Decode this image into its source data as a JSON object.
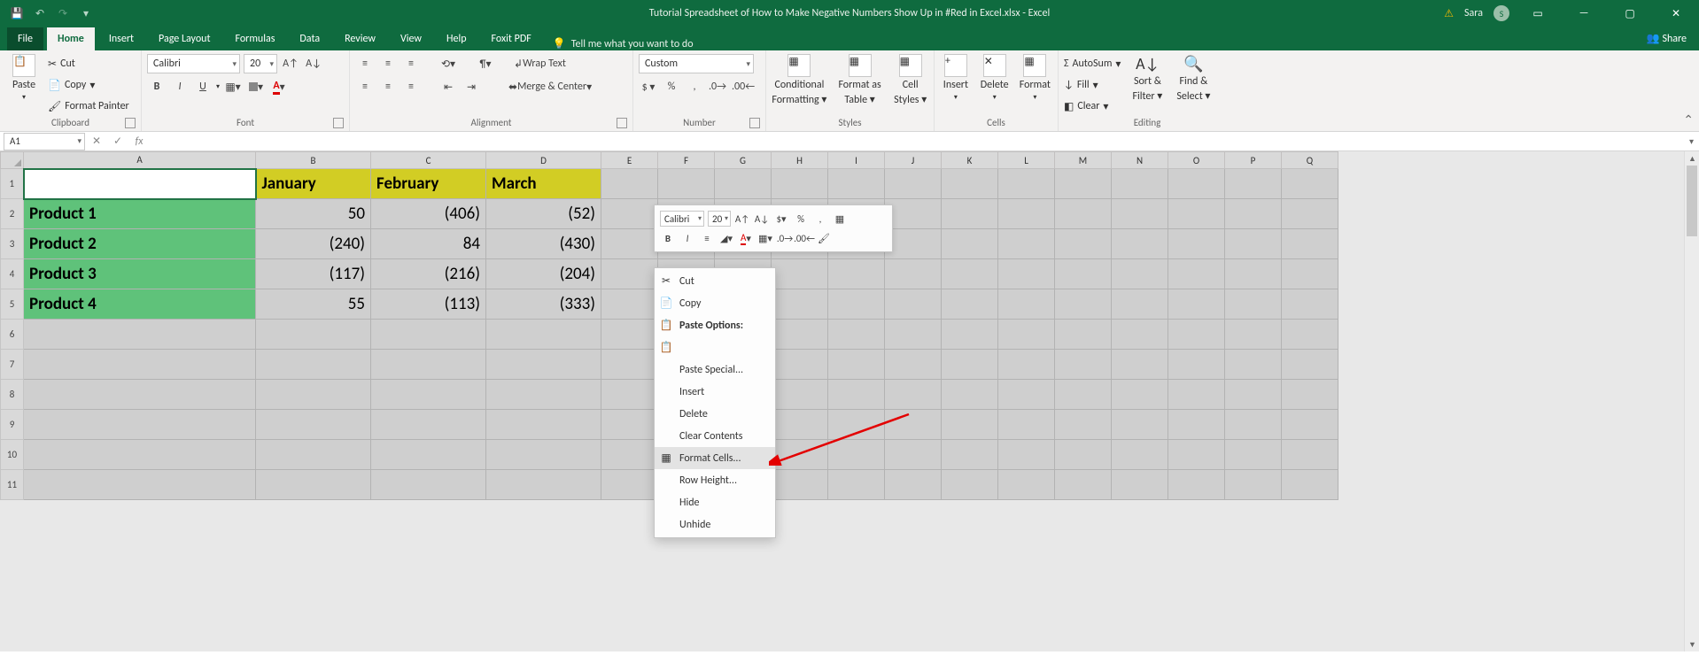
{
  "titlebar": {
    "title": "Tutorial Spreadsheet of How to Make Negative Numbers Show Up in #Red in Excel.xlsx - Excel",
    "user_name": "Sara",
    "user_initial": "S",
    "warning_icon": "warning"
  },
  "ribbon_tabs": {
    "file": "File",
    "home": "Home",
    "insert": "Insert",
    "page_layout": "Page Layout",
    "formulas": "Formulas",
    "data": "Data",
    "review": "Review",
    "view": "View",
    "help": "Help",
    "foxit": "Foxit PDF",
    "tell_me": "Tell me what you want to do",
    "share": "Share"
  },
  "clipboard": {
    "paste": "Paste",
    "cut": "Cut",
    "copy": "Copy",
    "format_painter": "Format Painter",
    "group_label": "Clipboard"
  },
  "font": {
    "name": "Calibri",
    "size": "20",
    "group_label": "Font"
  },
  "alignment": {
    "wrap": "Wrap Text",
    "merge": "Merge & Center",
    "group_label": "Alignment"
  },
  "number": {
    "format": "Custom",
    "group_label": "Number"
  },
  "styles": {
    "cond_fmt1": "Conditional",
    "cond_fmt2": "Formatting",
    "fmt_table1": "Format as",
    "fmt_table2": "Table",
    "cell_styles1": "Cell",
    "cell_styles2": "Styles",
    "group_label": "Styles"
  },
  "cells": {
    "insert": "Insert",
    "delete": "Delete",
    "format": "Format",
    "group_label": "Cells"
  },
  "editing": {
    "autosum": "AutoSum",
    "fill": "Fill",
    "clear": "Clear",
    "sort1": "Sort &",
    "sort2": "Filter",
    "find1": "Find &",
    "find2": "Select",
    "group_label": "Editing"
  },
  "name_box": "A1",
  "columns": [
    "A",
    "B",
    "C",
    "D",
    "E",
    "F",
    "G",
    "H",
    "I",
    "J",
    "K",
    "L",
    "M",
    "N",
    "O",
    "P",
    "Q"
  ],
  "row_numbers": [
    "1",
    "2",
    "3",
    "4",
    "5",
    "6",
    "7",
    "8",
    "9",
    "10",
    "11"
  ],
  "table": {
    "headers": [
      "January",
      "February",
      "March"
    ],
    "rows": [
      {
        "label": "Product 1",
        "vals": [
          "50",
          "(406)",
          "(52)"
        ]
      },
      {
        "label": "Product 2",
        "vals": [
          "(240)",
          "84",
          "(430)"
        ]
      },
      {
        "label": "Product 3",
        "vals": [
          "(117)",
          "(216)",
          "(204)"
        ]
      },
      {
        "label": "Product 4",
        "vals": [
          "55",
          "(113)",
          "(333)"
        ]
      }
    ]
  },
  "mini_toolbar": {
    "font": "Calibri",
    "size": "20"
  },
  "context_menu": {
    "cut": "Cut",
    "copy": "Copy",
    "paste_options": "Paste Options:",
    "paste_special": "Paste Special...",
    "insert": "Insert",
    "delete": "Delete",
    "clear_contents": "Clear Contents",
    "format_cells": "Format Cells...",
    "row_height": "Row Height...",
    "hide": "Hide",
    "unhide": "Unhide"
  }
}
